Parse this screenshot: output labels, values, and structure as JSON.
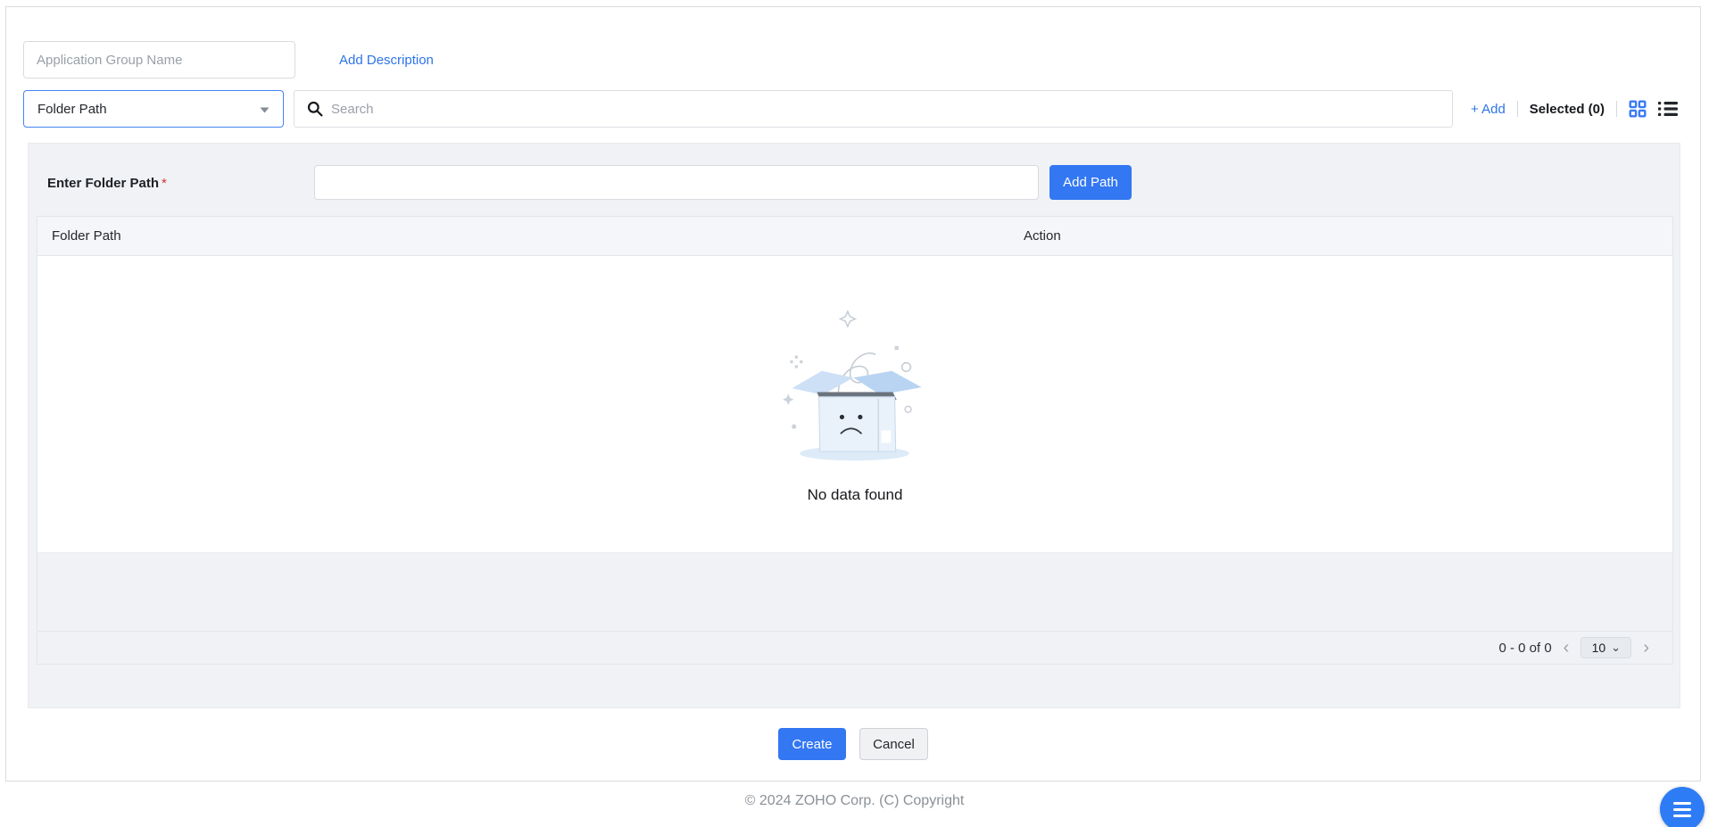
{
  "header": {
    "app_group_placeholder": "Application Group Name",
    "add_description": "Add Description"
  },
  "toolbar": {
    "filter_value": "Folder Path",
    "search_placeholder": "Search",
    "add_label": "+ Add",
    "selected_label": "Selected (0)"
  },
  "form": {
    "label": "Enter Folder Path",
    "required": "*",
    "input_value": "",
    "add_path": "Add Path"
  },
  "table": {
    "columns": [
      "Folder Path",
      "Action"
    ],
    "rows": [],
    "empty_text": "No data found"
  },
  "pagination": {
    "range": "0 - 0 of 0",
    "prev": "‹",
    "next": "›",
    "page_size": "10",
    "caret": "⌄"
  },
  "actions": {
    "create": "Create",
    "cancel": "Cancel"
  },
  "footer": {
    "copyright": "© 2024 ZOHO Corp. (C) Copyright"
  },
  "icons": {
    "search": "magnifier",
    "caret_down": "▾",
    "grid_view": "four-squares",
    "list_view": "list-lines",
    "fab_menu": "≡"
  },
  "colors": {
    "accent_blue": "#3377f2",
    "link_blue": "#2d74e8",
    "filter_border_blue": "#4285f4",
    "required_red": "#d0342c",
    "panel_gray": "#f0f2f5",
    "fab_blue": "#2e7cf5"
  }
}
